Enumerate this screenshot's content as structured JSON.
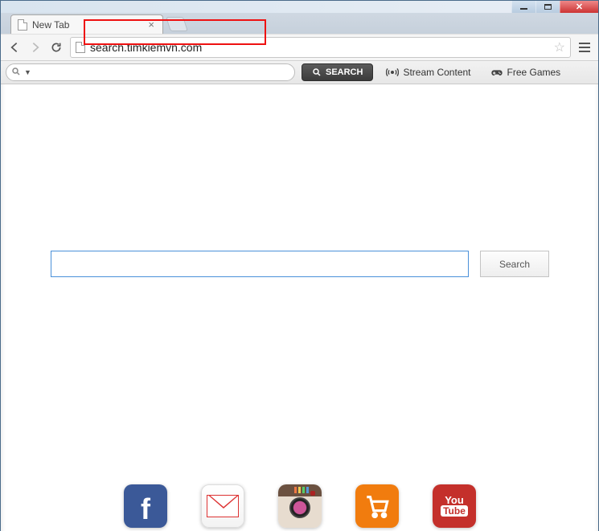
{
  "window": {
    "tab_title": "New Tab"
  },
  "nav": {
    "url": "search.timkiemvn.com"
  },
  "ext_toolbar": {
    "search_button": "SEARCH",
    "stream_label": "Stream Content",
    "games_label": "Free Games"
  },
  "page": {
    "search_button": "Search"
  },
  "apps": {
    "facebook": "f",
    "youtube_top": "You",
    "youtube_bottom": "Tube"
  }
}
